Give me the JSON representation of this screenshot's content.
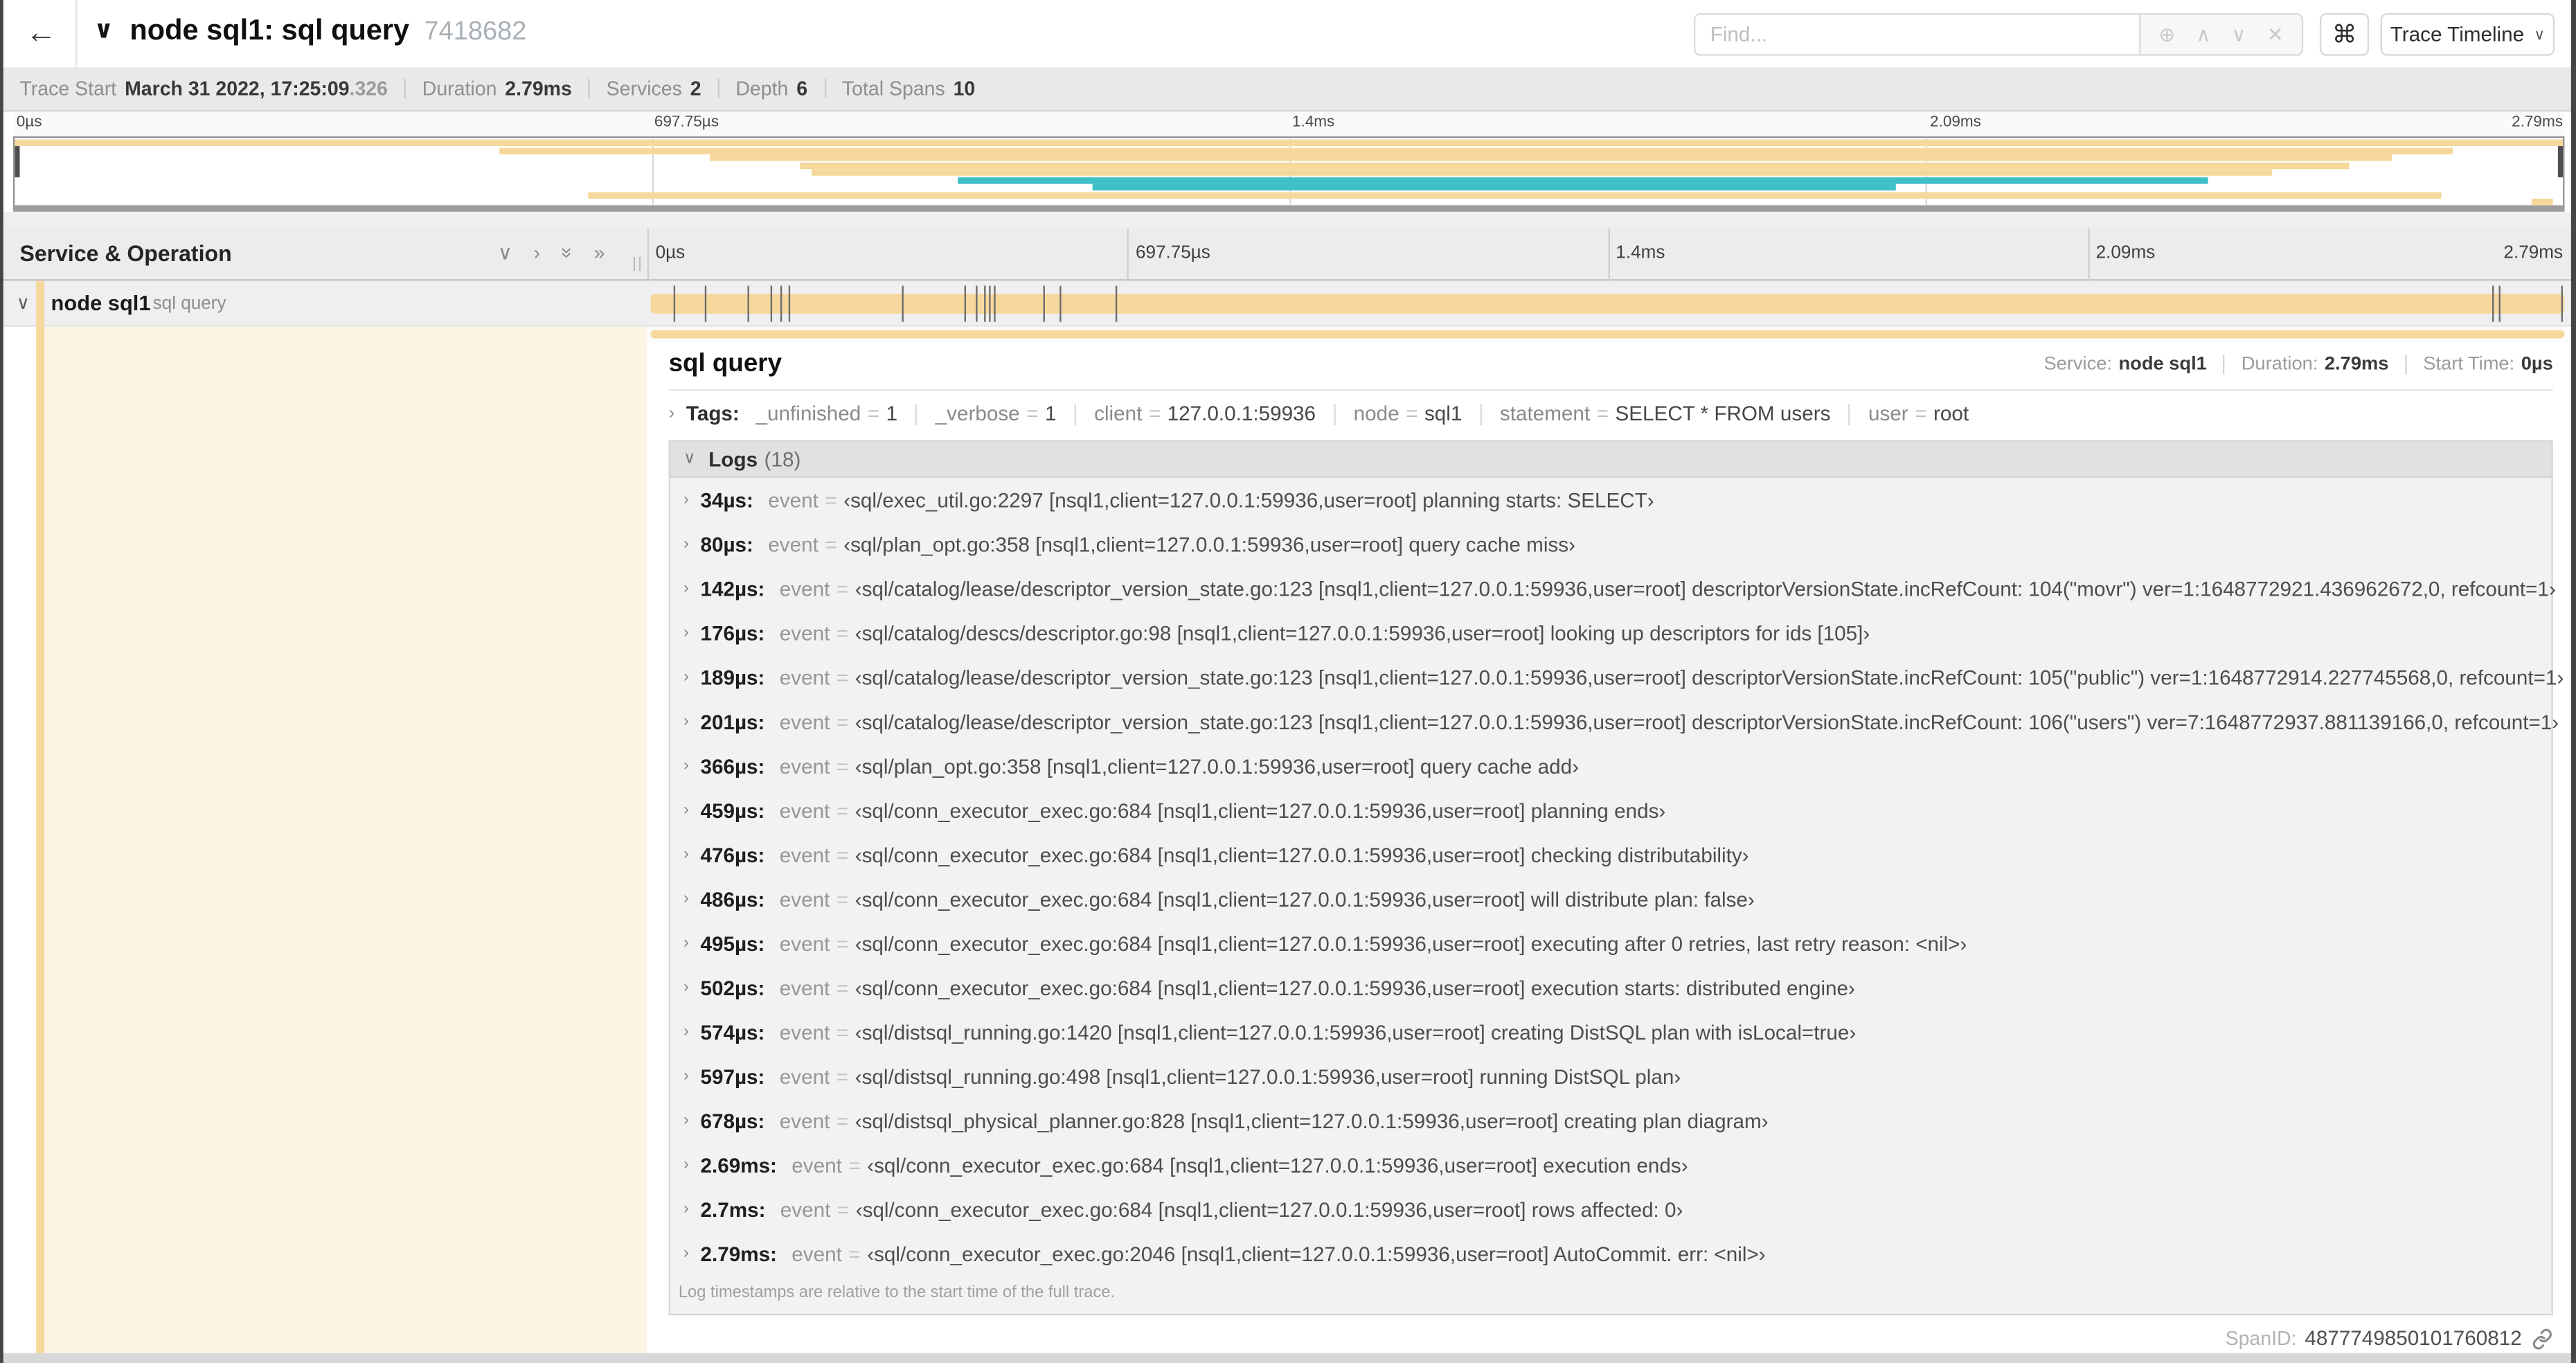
{
  "colors": {
    "tan": "#f6d89c",
    "teal": "#3fc0c6"
  },
  "header": {
    "back": "←",
    "caret": "∨",
    "title": "node sql1: sql query",
    "trace_id": "7418682",
    "find_placeholder": "Find...",
    "shortcut_button": "⌘",
    "view_dropdown": "Trace Timeline",
    "dropdown_caret": "∨",
    "find_icons": {
      "locate": "⊕",
      "prev": "∧",
      "next": "∨",
      "clear": "✕"
    }
  },
  "summary": {
    "items": [
      {
        "label": "Trace Start",
        "value": "March 31 2022, 17:25:09",
        "suffix": ".326"
      },
      {
        "label": "Duration",
        "value": "2.79ms",
        "suffix": ""
      },
      {
        "label": "Services",
        "value": "2",
        "suffix": ""
      },
      {
        "label": "Depth",
        "value": "6",
        "suffix": ""
      },
      {
        "label": "Total Spans",
        "value": "10",
        "suffix": ""
      }
    ]
  },
  "timeline": {
    "ticks": [
      "0µs",
      "697.75µs",
      "1.4ms",
      "2.09ms",
      "2.79ms"
    ],
    "tick_fractions": [
      0,
      0.25,
      0.5,
      0.75,
      1
    ]
  },
  "minimap": {
    "spans": [
      {
        "start": 0.0,
        "end": 1.0,
        "row": 0,
        "color": "tan"
      },
      {
        "start": 0.19,
        "end": 0.957,
        "row": 1,
        "color": "tan"
      },
      {
        "start": 0.273,
        "end": 0.933,
        "row": 2,
        "color": "tan"
      },
      {
        "start": 0.308,
        "end": 0.916,
        "row": 3,
        "color": "tan"
      },
      {
        "start": 0.313,
        "end": 0.886,
        "row": 4,
        "color": "tan"
      },
      {
        "start": 0.37,
        "end": 0.861,
        "row": 5,
        "color": "teal"
      },
      {
        "start": 0.423,
        "end": 0.738,
        "row": 6,
        "color": "teal"
      },
      {
        "start": 0.225,
        "end": 0.952,
        "row": 7,
        "color": "tan"
      },
      {
        "start": 0.988,
        "end": 0.996,
        "row": 8,
        "color": "tan"
      }
    ]
  },
  "left_panel": {
    "title": "Service & Operation",
    "icons": {
      "collapse_one": "∨",
      "expand_one": "›",
      "collapse_all": "»",
      "expand_all": "»",
      "grip": "||"
    }
  },
  "span_row": {
    "caret": "∨",
    "service": "node sql1",
    "operation": "sql query",
    "total_us": 2790,
    "log_ticks_us": [
      34,
      80,
      142,
      176,
      189,
      201,
      366,
      459,
      476,
      486,
      495,
      502,
      574,
      597,
      678,
      2690,
      2700,
      2790
    ]
  },
  "detail": {
    "title": "sql query",
    "meta": [
      {
        "label": "Service:",
        "value": "node sql1"
      },
      {
        "label": "Duration:",
        "value": "2.79ms"
      },
      {
        "label": "Start Time:",
        "value": "0µs"
      }
    ],
    "tags": {
      "caret": "›",
      "label": "Tags:",
      "items": [
        {
          "key": "_unfinished",
          "value": "1"
        },
        {
          "key": "_verbose",
          "value": "1"
        },
        {
          "key": "client",
          "value": "127.0.0.1:59936"
        },
        {
          "key": "node",
          "value": "sql1"
        },
        {
          "key": "statement",
          "value": "SELECT * FROM users"
        },
        {
          "key": "user",
          "value": "root"
        }
      ]
    },
    "logs": {
      "caret": "∨",
      "label": "Logs",
      "count": "(18)",
      "row_caret": "›",
      "rows": [
        {
          "time": "34µs:",
          "key": "event",
          "value": "‹sql/exec_util.go:2297 [nsql1,client=127.0.0.1:59936,user=root] planning starts: SELECT›"
        },
        {
          "time": "80µs:",
          "key": "event",
          "value": "‹sql/plan_opt.go:358 [nsql1,client=127.0.0.1:59936,user=root] query cache miss›"
        },
        {
          "time": "142µs:",
          "key": "event",
          "value": "‹sql/catalog/lease/descriptor_version_state.go:123 [nsql1,client=127.0.0.1:59936,user=root] descriptorVersionState.incRefCount: 104(\"movr\") ver=1:1648772921.436962672,0, refcount=1›"
        },
        {
          "time": "176µs:",
          "key": "event",
          "value": "‹sql/catalog/descs/descriptor.go:98 [nsql1,client=127.0.0.1:59936,user=root] looking up descriptors for ids [105]›"
        },
        {
          "time": "189µs:",
          "key": "event",
          "value": "‹sql/catalog/lease/descriptor_version_state.go:123 [nsql1,client=127.0.0.1:59936,user=root] descriptorVersionState.incRefCount: 105(\"public\") ver=1:1648772914.227745568,0, refcount=1›"
        },
        {
          "time": "201µs:",
          "key": "event",
          "value": "‹sql/catalog/lease/descriptor_version_state.go:123 [nsql1,client=127.0.0.1:59936,user=root] descriptorVersionState.incRefCount: 106(\"users\") ver=7:1648772937.881139166,0, refcount=1›"
        },
        {
          "time": "366µs:",
          "key": "event",
          "value": "‹sql/plan_opt.go:358 [nsql1,client=127.0.0.1:59936,user=root] query cache add›"
        },
        {
          "time": "459µs:",
          "key": "event",
          "value": "‹sql/conn_executor_exec.go:684 [nsql1,client=127.0.0.1:59936,user=root] planning ends›"
        },
        {
          "time": "476µs:",
          "key": "event",
          "value": "‹sql/conn_executor_exec.go:684 [nsql1,client=127.0.0.1:59936,user=root] checking distributability›"
        },
        {
          "time": "486µs:",
          "key": "event",
          "value": "‹sql/conn_executor_exec.go:684 [nsql1,client=127.0.0.1:59936,user=root] will distribute plan: false›"
        },
        {
          "time": "495µs:",
          "key": "event",
          "value": "‹sql/conn_executor_exec.go:684 [nsql1,client=127.0.0.1:59936,user=root] executing after 0 retries, last retry reason: <nil>›"
        },
        {
          "time": "502µs:",
          "key": "event",
          "value": "‹sql/conn_executor_exec.go:684 [nsql1,client=127.0.0.1:59936,user=root] execution starts: distributed engine›"
        },
        {
          "time": "574µs:",
          "key": "event",
          "value": "‹sql/distsql_running.go:1420 [nsql1,client=127.0.0.1:59936,user=root] creating DistSQL plan with isLocal=true›"
        },
        {
          "time": "597µs:",
          "key": "event",
          "value": "‹sql/distsql_running.go:498 [nsql1,client=127.0.0.1:59936,user=root] running DistSQL plan›"
        },
        {
          "time": "678µs:",
          "key": "event",
          "value": "‹sql/distsql_physical_planner.go:828 [nsql1,client=127.0.0.1:59936,user=root] creating plan diagram›"
        },
        {
          "time": "2.69ms:",
          "key": "event",
          "value": "‹sql/conn_executor_exec.go:684 [nsql1,client=127.0.0.1:59936,user=root] execution ends›"
        },
        {
          "time": "2.7ms:",
          "key": "event",
          "value": "‹sql/conn_executor_exec.go:684 [nsql1,client=127.0.0.1:59936,user=root] rows affected: 0›"
        },
        {
          "time": "2.79ms:",
          "key": "event",
          "value": "‹sql/conn_executor_exec.go:2046 [nsql1,client=127.0.0.1:59936,user=root] AutoCommit. err: <nil>›"
        }
      ],
      "footnote": "Log timestamps are relative to the start time of the full trace."
    },
    "span_id": {
      "label": "SpanID:",
      "value": "4877749850101760812"
    }
  }
}
